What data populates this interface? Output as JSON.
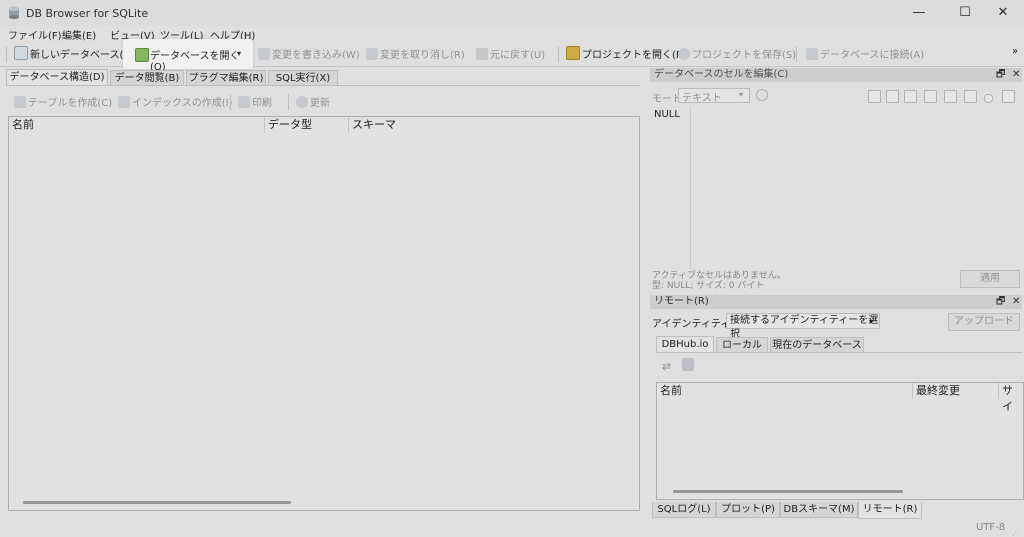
{
  "window": {
    "title": "DB Browser for SQLite",
    "controls": [
      "—",
      "☐",
      "✕"
    ]
  },
  "menu": [
    "ファイル(F)",
    "編集(E)",
    "ビュー(V)",
    "ツール(L)",
    "ヘルプ(H)"
  ],
  "toolbar": {
    "new_db": "新しいデータベース(N)",
    "open_db": "データベースを開く(O)",
    "write_changes": "変更を書き込み(W)",
    "revert_changes": "変更を取り消し(R)",
    "undo": "元に戻す(U)",
    "open_project": "プロジェクトを開く(P)",
    "save_project": "プロジェクトを保存(S)",
    "attach_db": "データベースに接続(A)",
    "more": "»"
  },
  "left_tabs": [
    "データベース構造(D)",
    "データ閲覧(B)",
    "プラグマ編集(R)",
    "SQL実行(X)"
  ],
  "struct_toolbar": {
    "create_table": "テーブルを作成(C)",
    "create_index": "インデックスの作成(I)",
    "print": "印刷",
    "refresh": "更新"
  },
  "struct_columns": [
    "名前",
    "データ型",
    "スキーマ"
  ],
  "edit_cell": {
    "title": "データベースのセルを編集(C)",
    "mode_label": "モード:",
    "mode_value": "テキスト",
    "null_text": "NULL",
    "status_line1": "アクティブなセルはありません。",
    "status_line2": "型: NULL; サイズ: 0 バイト",
    "apply": "適用"
  },
  "remote": {
    "title": "リモート(R)",
    "identity_label": "アイデンティティー",
    "identity_value": "接続するアイデンティティーを選択",
    "upload": "アップロード",
    "tabs": [
      "DBHub.io",
      "ローカル",
      "現在のデータベース"
    ],
    "columns": [
      "名前",
      "最終変更",
      "サイ"
    ]
  },
  "bottom_tabs": [
    "SQLログ(L)",
    "プロット(P)",
    "DBスキーマ(M)",
    "リモート(R)"
  ],
  "status": {
    "encoding": "UTF-8"
  },
  "dock_controls": {
    "float": "🗗",
    "close": "✕"
  }
}
